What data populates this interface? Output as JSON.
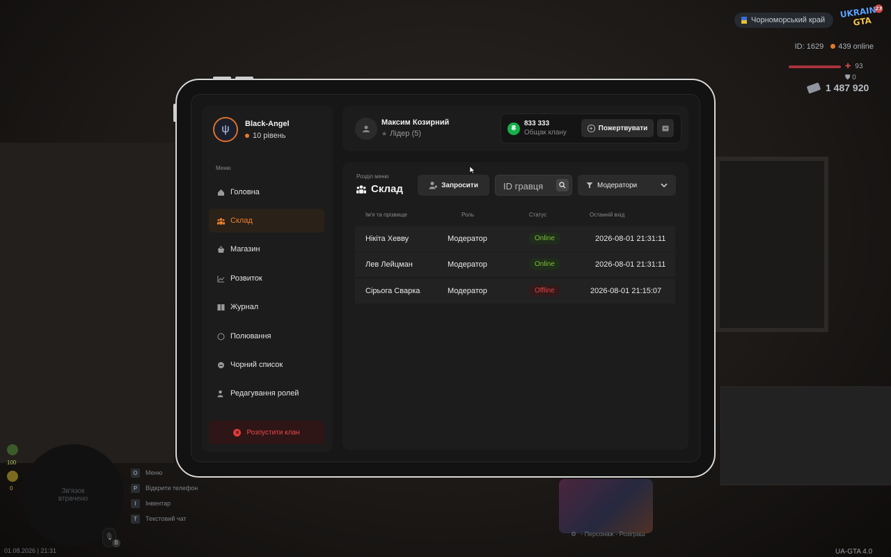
{
  "hud": {
    "region": "Чорноморський край",
    "logo_line1": "UKRAINE",
    "logo_line2": "GTA",
    "logo_badge": "23",
    "player_id": "ID: 1629",
    "online": "439 online",
    "health": "93",
    "armor": "0",
    "money": "1 487 920",
    "stat1": "100",
    "stat2": "0",
    "minimap_text": "Зв'язок втрачено",
    "keys": [
      {
        "key": "O",
        "label": "Меню"
      },
      {
        "key": "P",
        "label": "Відкрити телефон"
      },
      {
        "key": "I",
        "label": "Інвентар"
      },
      {
        "key": "T",
        "label": "Текстовий чат"
      }
    ],
    "datetime": "01.08.2026 | 21:31",
    "mic_key": "B",
    "promo_bar": "- Персонаж - Розіграш",
    "version": "UA-GTA 4.0"
  },
  "sidebar": {
    "clan_name": "Black-Angel",
    "clan_level": "10 рівень",
    "menu_caption": "Меню",
    "items": [
      {
        "label": "Головна",
        "icon": "home-icon"
      },
      {
        "label": "Склад",
        "icon": "people-icon",
        "active": true
      },
      {
        "label": "Магазин",
        "icon": "basket-icon"
      },
      {
        "label": "Розвиток",
        "icon": "chart-icon"
      },
      {
        "label": "Журнал",
        "icon": "book-icon"
      },
      {
        "label": "Полювання",
        "icon": "target-icon"
      },
      {
        "label": "Чорний список",
        "icon": "block-icon"
      },
      {
        "label": "Редагування ролей",
        "icon": "user-edit-icon"
      }
    ],
    "disband_label": "Розпустити клан"
  },
  "header": {
    "leader_name": "Максим Козирний",
    "leader_role": "Лідер (5)",
    "bank_amount": "833 333",
    "bank_label": "Общак клану",
    "bank_currency_symbol": "₴",
    "donate_label": "Пожертвувати"
  },
  "main": {
    "section_caption": "Розділ меню",
    "section_title": "Склад",
    "invite_label": "Запросити",
    "search_placeholder": "ID гравця",
    "filter_value": "Модератори",
    "columns": [
      "Ім'я та прізвище",
      "Роль",
      "Статус",
      "Останній вхід"
    ],
    "rows": [
      {
        "name": "Нікіта Хевву",
        "role": "Модератор",
        "status": "Online",
        "last": "2026-08-01 21:31:11"
      },
      {
        "name": "Лев Лейцман",
        "role": "Модератор",
        "status": "Online",
        "last": "2026-08-01 21:31:11"
      },
      {
        "name": "Сірьога Сварка",
        "role": "Модератор",
        "status": "Offline",
        "last": "2026-08-01 21:15:07"
      }
    ]
  },
  "colors": {
    "accent": "#f0812d",
    "online": "#7fbf38",
    "offline": "#e04141",
    "bank_green": "#14b04a"
  }
}
